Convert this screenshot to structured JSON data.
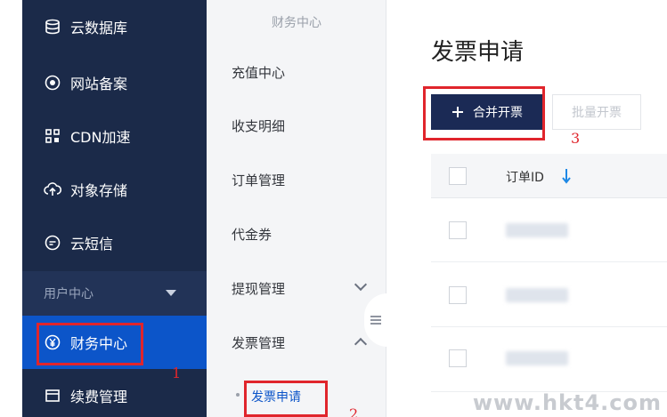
{
  "sidebar": {
    "items": [
      {
        "label": "云数据库",
        "icon": "database-icon"
      },
      {
        "label": "网站备案",
        "icon": "record-icon"
      },
      {
        "label": "CDN加速",
        "icon": "grid-icon"
      },
      {
        "label": "对象存储",
        "icon": "cloud-upload-icon"
      },
      {
        "label": "云短信",
        "icon": "message-icon"
      }
    ],
    "group_label": "用户中心",
    "group_items": [
      {
        "label": "财务中心",
        "icon": "yen-icon",
        "active": true
      },
      {
        "label": "续费管理",
        "icon": "window-icon"
      }
    ]
  },
  "subnav": {
    "title": "财务中心",
    "items": [
      "充值中心",
      "收支明细",
      "订单管理",
      "代金券",
      "提现管理",
      "发票管理"
    ],
    "selected": "发票申请"
  },
  "main": {
    "title": "发票申请",
    "merge_button": "合并开票",
    "batch_button": "批量开票",
    "table": {
      "column": "订单ID"
    }
  },
  "annotations": {
    "n1": "1",
    "n2": "2",
    "n3": "3"
  },
  "watermark": "www.hkt4.com",
  "colors": {
    "sidebar": "#1b2a49",
    "active": "#0c55c9",
    "highlight": "#e0252c",
    "primary_button": "#1b2a55",
    "sort_arrow": "#1e88e5"
  }
}
